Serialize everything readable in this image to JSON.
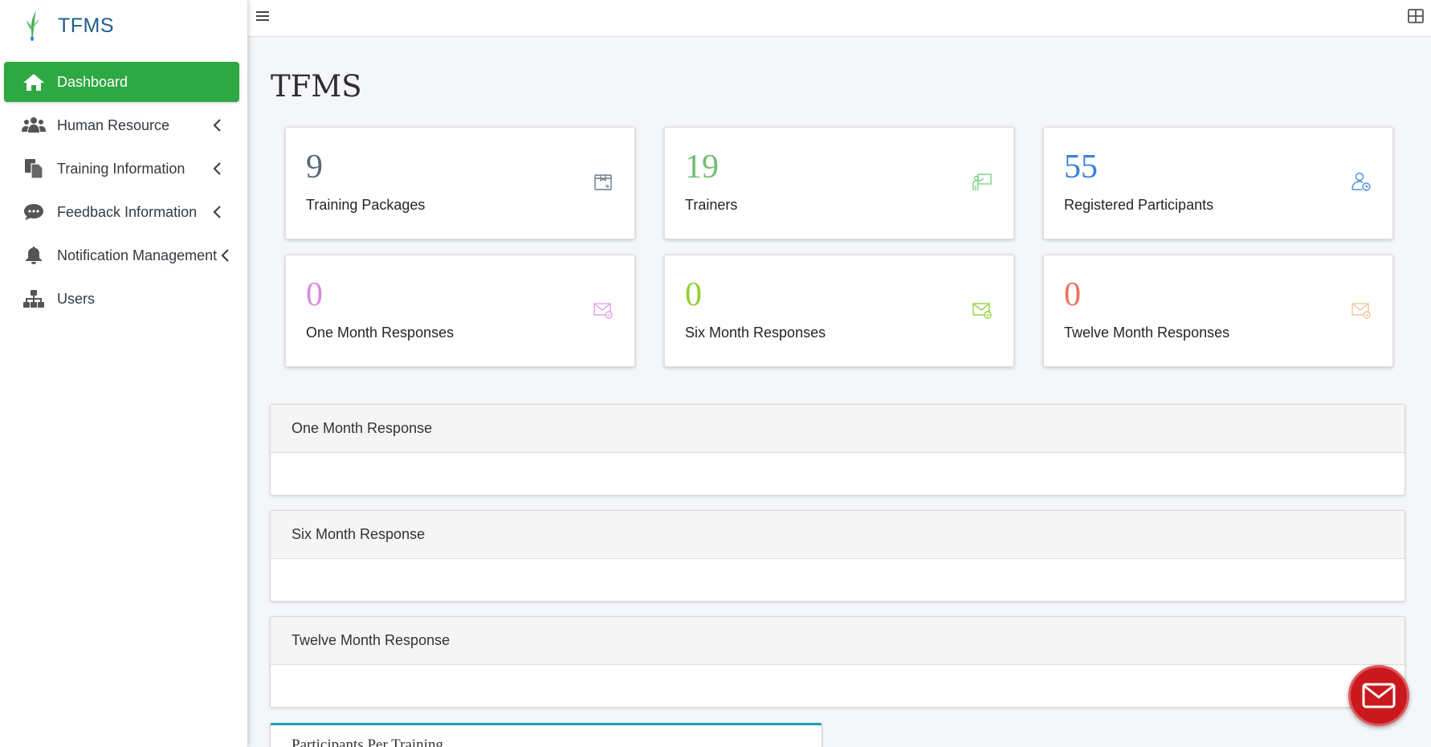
{
  "brand": {
    "name": "TFMS"
  },
  "sidebar": {
    "items": [
      {
        "label": "Dashboard",
        "icon": "home-icon",
        "active": true
      },
      {
        "label": "Human Resource",
        "icon": "users-icon",
        "has_submenu": true
      },
      {
        "label": "Training Information",
        "icon": "copy-icon",
        "has_submenu": true
      },
      {
        "label": "Feedback Information",
        "icon": "comment-icon",
        "has_submenu": true
      },
      {
        "label": "Notification Management",
        "icon": "bell-icon",
        "has_submenu": true
      },
      {
        "label": "Users",
        "icon": "sitemap-icon"
      }
    ]
  },
  "page": {
    "title": "TFMS"
  },
  "stats": [
    {
      "value": "9",
      "label": "Training Packages",
      "color": "#5a6b7b",
      "icon": "package-icon"
    },
    {
      "value": "19",
      "label": "Trainers",
      "color": "#6fbf73",
      "icon": "trainer-icon"
    },
    {
      "value": "55",
      "label": "Registered Participants",
      "color": "#3b7fd9",
      "icon": "participant-icon"
    },
    {
      "value": "0",
      "label": "One Month Responses",
      "color": "#d98be0",
      "icon": "mail-response-icon"
    },
    {
      "value": "0",
      "label": "Six Month Responses",
      "color": "#8fd12f",
      "icon": "mail-response-icon"
    },
    {
      "value": "0",
      "label": "Twelve Month Responses",
      "color": "#e8735a",
      "icon": "mail-response-icon"
    }
  ],
  "panels": [
    {
      "title": "One Month Response"
    },
    {
      "title": "Six Month Response"
    },
    {
      "title": "Twelve Month Response"
    }
  ],
  "partial_panel": {
    "title": "Participants Per Training"
  },
  "colors": {
    "accent": "#2ea843",
    "fab": "#c9191e",
    "partial_panel_border": "#17a2b8"
  }
}
